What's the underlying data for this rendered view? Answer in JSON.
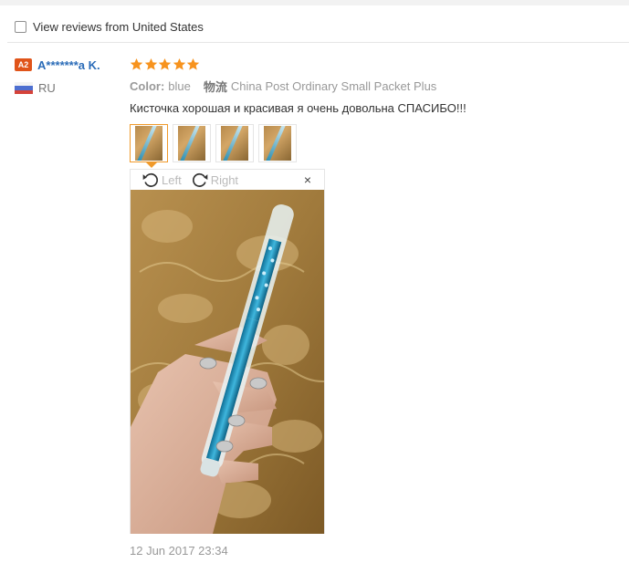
{
  "filter": {
    "label": "View reviews from United States",
    "checked": false
  },
  "user": {
    "level": "A2",
    "name": "A*******a K.",
    "country_code": "RU"
  },
  "review": {
    "rating": 5,
    "color_label": "Color:",
    "color_value": "blue",
    "shipping_label": "物流",
    "shipping_value": "China Post Ordinary Small Packet Plus",
    "feedback": "Кисточка хорошая и красивая я очень довольна СПАСИБО!!!",
    "date": "12 Jun 2017 23:34"
  },
  "viewer": {
    "rotate_left": "Left",
    "rotate_right": "Right",
    "close": "×"
  },
  "colors": {
    "star": "#f7931e",
    "link": "#2b6cb8",
    "badge": "#e0541a",
    "thumb_active": "#f09a2b"
  }
}
